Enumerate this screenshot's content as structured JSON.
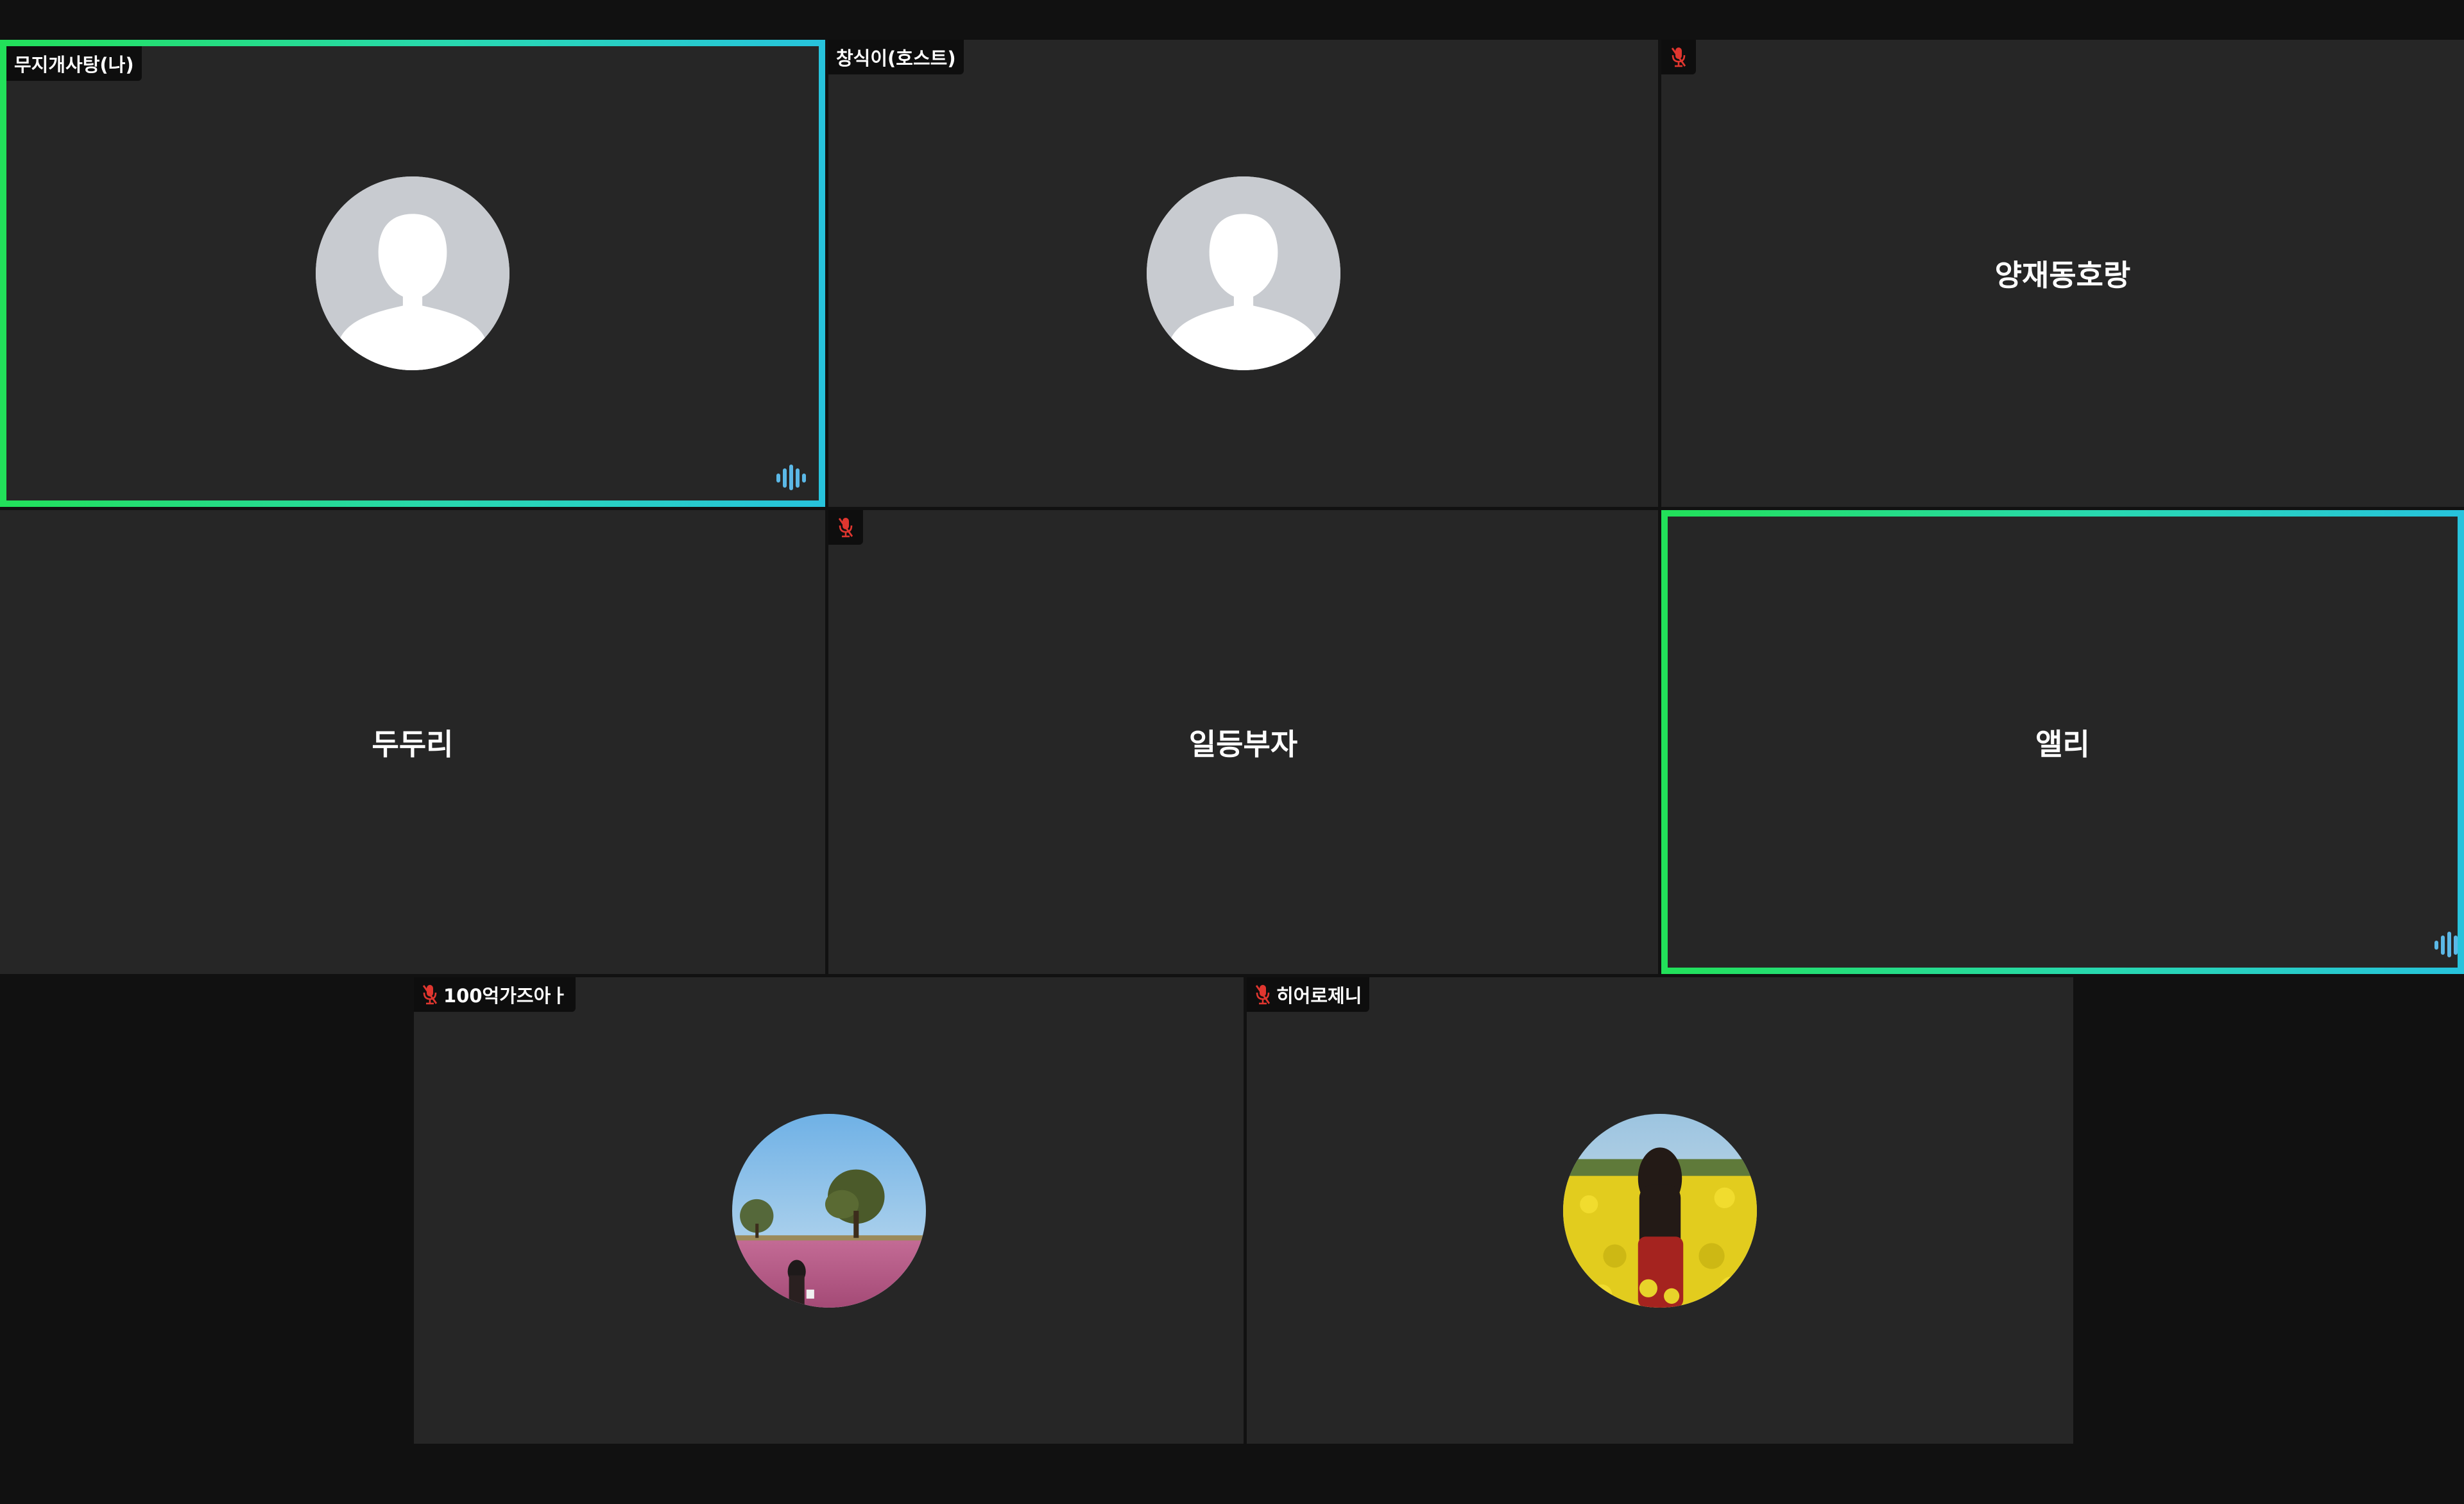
{
  "meeting": {
    "participants": [
      {
        "name": "무지개사탕(나)",
        "muted": false,
        "speaking": true,
        "display": "default-avatar"
      },
      {
        "name": "창식이(호스트)",
        "muted": false,
        "speaking": false,
        "display": "default-avatar"
      },
      {
        "name": "양재동호랑",
        "muted": true,
        "speaking": false,
        "display": "name-only"
      },
      {
        "name": "두두리",
        "muted": false,
        "speaking": false,
        "display": "name-only"
      },
      {
        "name": "일등부자",
        "muted": true,
        "speaking": false,
        "display": "name-only"
      },
      {
        "name": "앨리",
        "muted": false,
        "speaking": true,
        "display": "name-only"
      },
      {
        "name": "100억가즈아ㅏ",
        "muted": true,
        "speaking": false,
        "display": "photo-avatar-pink-field"
      },
      {
        "name": "히어로제니",
        "muted": true,
        "speaking": false,
        "display": "photo-avatar-yellow-field"
      }
    ]
  },
  "colors": {
    "background": "#111111",
    "tile": "#262626",
    "speaking_border_start": "#22e05a",
    "speaking_border_end": "#27c3dc",
    "mute_icon": "#e0362f",
    "audio_indicator": "#5bb8e6",
    "default_avatar": "#c8cbd0"
  },
  "icons": {
    "mute": "microphone-muted-icon",
    "audio": "audio-level-icon",
    "default_avatar": "person-silhouette-icon"
  }
}
